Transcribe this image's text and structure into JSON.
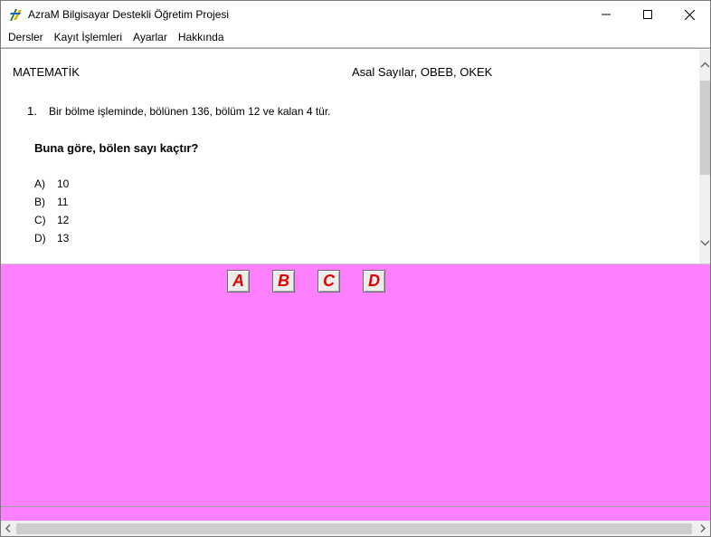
{
  "window": {
    "title": "AzraM Bilgisayar Destekli Öğretim Projesi",
    "icon": "azram-app-icon"
  },
  "menu": {
    "items": [
      {
        "label": "Dersler"
      },
      {
        "label": "Kayıt İşlemleri"
      },
      {
        "label": "Ayarlar"
      },
      {
        "label": "Hakkında"
      }
    ]
  },
  "lesson": {
    "subject": "MATEMATİK",
    "topic": "Asal Sayılar, OBEB, OKEK"
  },
  "question": {
    "number": "1.",
    "text": "Bir bölme işleminde, bölünen 136, bölüm 12 ve kalan 4 tür.",
    "prompt": "Buna göre, bölen sayı kaçtır?",
    "options": [
      {
        "letter": "A)",
        "value": "10"
      },
      {
        "letter": "B)",
        "value": "11"
      },
      {
        "letter": "C)",
        "value": "12"
      },
      {
        "letter": "D)",
        "value": "13"
      }
    ]
  },
  "answers": {
    "buttons": [
      {
        "label": "A"
      },
      {
        "label": "B"
      },
      {
        "label": "C"
      },
      {
        "label": "D"
      }
    ]
  },
  "colors": {
    "answer_panel": "#ff80ff",
    "answer_letter": "#e00000"
  }
}
